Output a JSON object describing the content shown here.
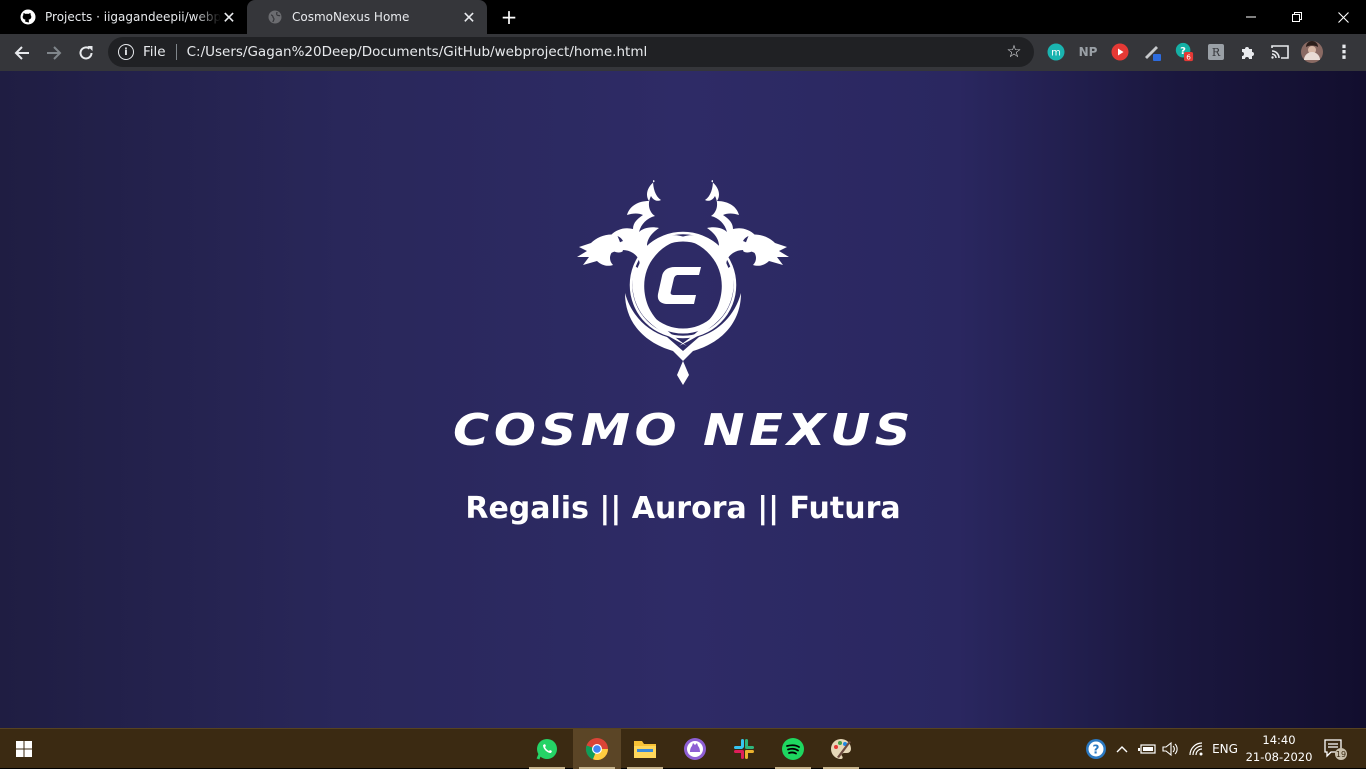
{
  "browser": {
    "tabs": [
      {
        "title": "Projects · iigagandeepii/webproject",
        "favicon": "github-icon",
        "active": false
      },
      {
        "title": "CosmoNexus Home",
        "favicon": "globe-icon",
        "active": true
      }
    ],
    "new_tab_label": "+",
    "window_controls": {
      "minimize": "—",
      "restore": "❐",
      "close": "✕"
    },
    "omnibox": {
      "scheme_label": "File",
      "url": "C:/Users/Gagan%20Deep/Documents/GitHub/webproject/home.html"
    },
    "extensions": [
      {
        "name": "m-extension-icon",
        "text": "m"
      },
      {
        "name": "np-extension-icon",
        "text": "NP"
      },
      {
        "name": "youtube-extension-icon",
        "text": ""
      },
      {
        "name": "pen-extension-icon",
        "text": ""
      },
      {
        "name": "grammar-extension-icon",
        "text": "6"
      },
      {
        "name": "reader-extension-icon",
        "text": ""
      },
      {
        "name": "puzzle-icon",
        "text": ""
      },
      {
        "name": "cast-icon",
        "text": ""
      },
      {
        "name": "profile-avatar",
        "text": ""
      },
      {
        "name": "menu-icon",
        "text": "⋮"
      }
    ]
  },
  "page": {
    "brand_wordmark": "COSMO NEXUS",
    "emblem_letter": "C",
    "tagline": "Regalis || Aurora || Futura"
  },
  "taskbar": {
    "apps": [
      {
        "name": "whatsapp-icon",
        "active": false
      },
      {
        "name": "chrome-icon",
        "active": true
      },
      {
        "name": "file-explorer-icon",
        "active": false
      },
      {
        "name": "github-desktop-icon",
        "active": false
      },
      {
        "name": "slack-icon",
        "active": false
      },
      {
        "name": "spotify-icon",
        "active": false
      },
      {
        "name": "paint-icon",
        "active": false
      }
    ],
    "tray": {
      "language": "ENG",
      "time": "14:40",
      "date": "21-08-2020",
      "notification_count": "19"
    }
  },
  "colors": {
    "page_bg": "#2e2b66",
    "taskbar_bg": "#3b2a12",
    "toolbar_bg": "#35363a"
  }
}
